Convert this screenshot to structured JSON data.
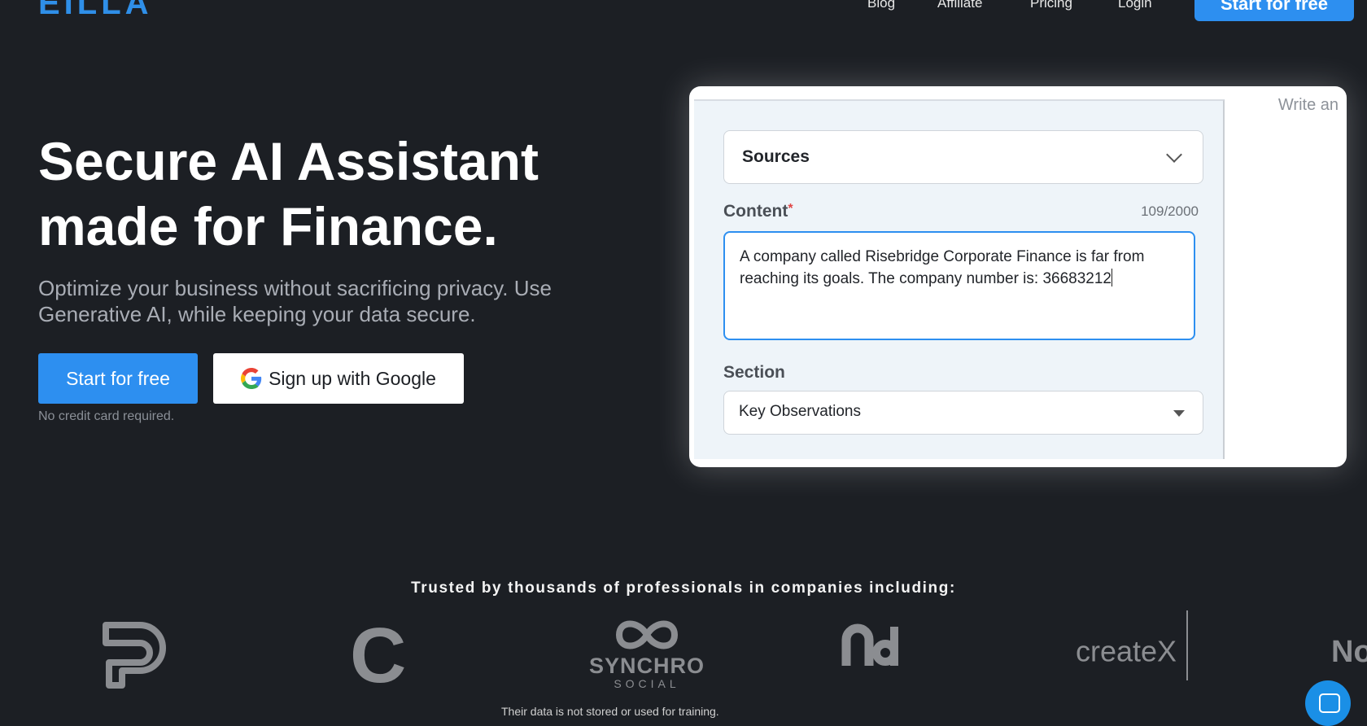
{
  "header": {
    "logo": "EILLA",
    "nav": [
      "Blog",
      "Affiliate",
      "Pricing",
      "Login"
    ],
    "cta_label": "Start for free"
  },
  "hero": {
    "title": "Secure AI Assistant made for Finance.",
    "subtitle": "Optimize your business without sacrificing privacy. Use Generative AI, while keeping your data secure.",
    "primary_button": "Start for free",
    "google_button": "Sign up with Google",
    "note": "No credit card required."
  },
  "app_preview": {
    "write_hint": "Write an",
    "sources_label": "Sources",
    "content_label": "Content",
    "required_mark": "*",
    "counter": "109/2000",
    "content_text": "A company called Risebridge Corporate Finance is far from reaching its goals. The company number is: 36683212",
    "section_label": "Section",
    "section_value": "Key Observations"
  },
  "trusted": {
    "heading": "Trusted by thousands of professionals in companies including:",
    "logos": {
      "synchro_name": "SYNCHRO",
      "synchro_sub": "SOCIAL",
      "createx": "createX",
      "partial": "No"
    },
    "footnote": "Their data is not stored or used for training."
  },
  "colors": {
    "background": "#1c1f24",
    "accent": "#2d8ff0",
    "logo_gray": "#8b8d91"
  }
}
